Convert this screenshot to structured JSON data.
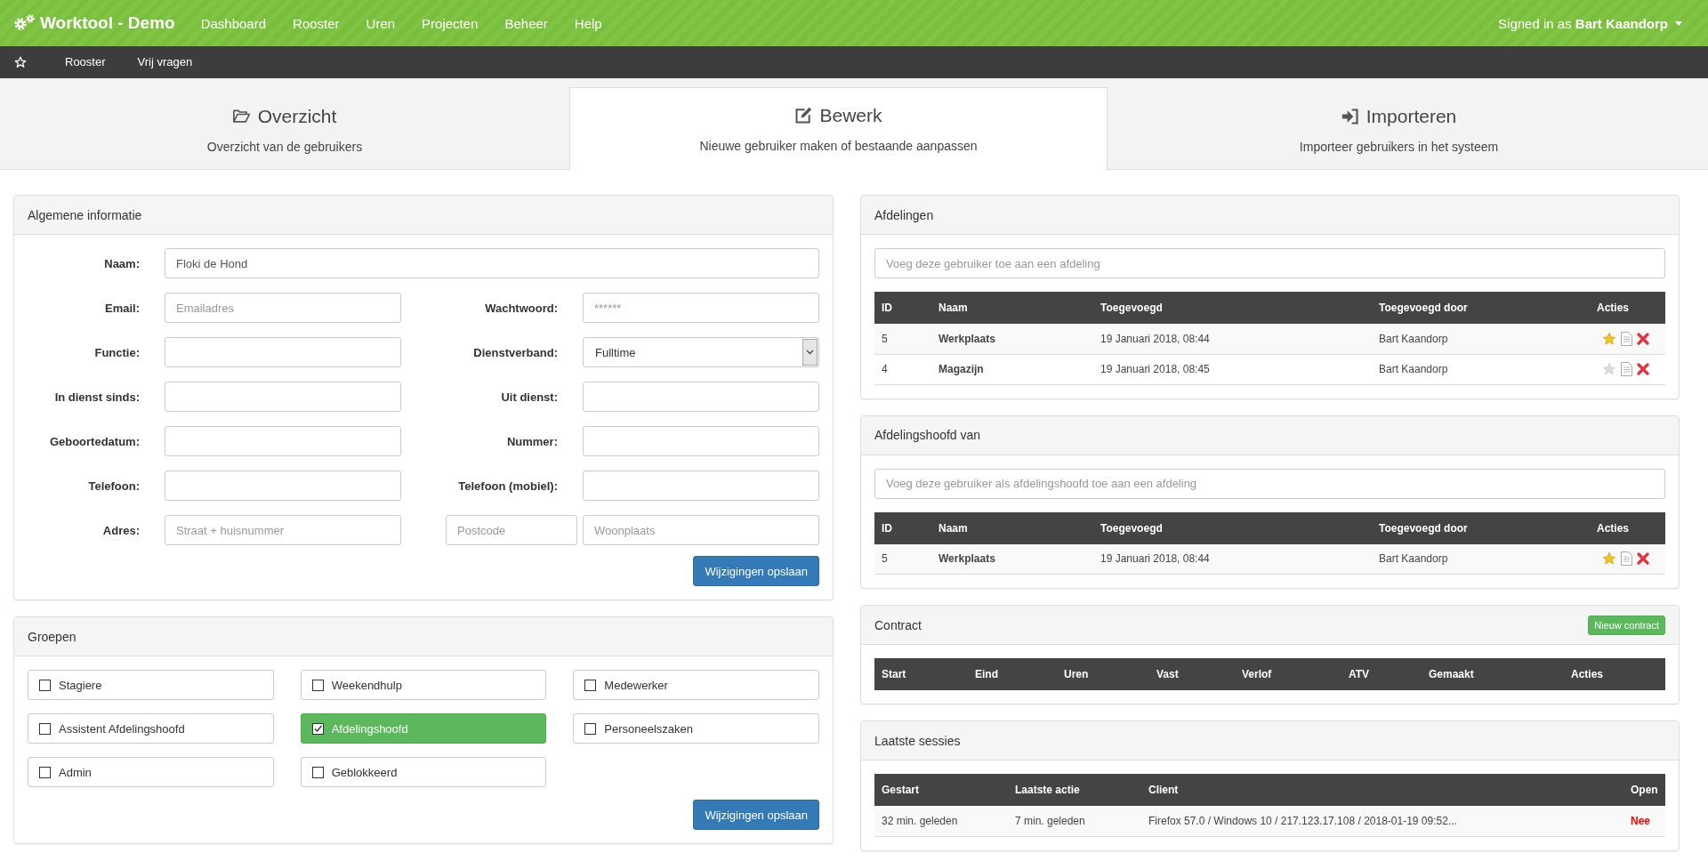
{
  "navbar": {
    "brand": "Worktool - Demo",
    "items": [
      {
        "label": "Dashboard"
      },
      {
        "label": "Rooster"
      },
      {
        "label": "Uren"
      },
      {
        "label": "Projecten"
      },
      {
        "label": "Beheer"
      },
      {
        "label": "Help"
      }
    ],
    "user": "Signed in as **Bart Kaandorp**"
  },
  "subnav": {
    "items": [
      {
        "label": "Rooster"
      },
      {
        "label": "Vrij vragen"
      }
    ]
  },
  "tabs": [
    {
      "title": "Overzicht",
      "subtitle": "Overzicht van de gebruikers",
      "selected": false
    },
    {
      "title": "Bewerk",
      "subtitle": "Nieuwe gebruiker maken of bestaande aanpassen",
      "selected": true
    },
    {
      "title": "Importeren",
      "subtitle": "Importeer gebruikers in het systeem",
      "selected": false
    }
  ],
  "general": {
    "title": "Algemene informatie",
    "rows": [
      [
        {
          "label": "Naam:",
          "kind": "input",
          "value": "Floki de Hond"
        }
      ],
      [
        {
          "label": "Email:",
          "kind": "input",
          "placeholder": "Emailadres"
        },
        {
          "label": "Wachtwoord:",
          "kind": "input",
          "placeholder": "******"
        }
      ],
      [
        {
          "label": "Functie:",
          "kind": "input"
        },
        {
          "label": "Dienstverband:",
          "kind": "select",
          "value": "Fulltime"
        }
      ],
      [
        {
          "label": "In dienst sinds:",
          "kind": "input"
        },
        {
          "label": "Uit dienst:",
          "kind": "input"
        }
      ],
      [
        {
          "label": "Geboortedatum:",
          "kind": "input"
        },
        {
          "label": "Nummer:",
          "kind": "input"
        }
      ],
      [
        {
          "label": "Telefoon:",
          "kind": "input"
        },
        {
          "label": "Telefoon (mobiel):",
          "kind": "input"
        }
      ],
      [
        {
          "label": "Adres:",
          "kind": "address",
          "inputs": [
            {
              "placeholder": "Straat + huisnummer"
            },
            {
              "placeholder": "Postcode"
            },
            {
              "placeholder": "Woonplaats"
            }
          ]
        }
      ]
    ],
    "save_button": "Wijzigingen opslaan"
  },
  "groups": {
    "title": "Groepen",
    "items": [
      {
        "label": "Stagiere",
        "checked": false
      },
      {
        "label": "Weekendhulp",
        "checked": false
      },
      {
        "label": "Medewerker",
        "checked": false
      },
      {
        "label": "Assistent Afdelingshoofd",
        "checked": false
      },
      {
        "label": "Afdelingshoofd",
        "checked": true
      },
      {
        "label": "Personeelszaken",
        "checked": false
      },
      {
        "label": "Admin",
        "checked": false
      },
      {
        "label": "Geblokkeerd",
        "checked": false
      }
    ],
    "save_button": "Wijzigingen opslaan"
  },
  "departments": {
    "title": "Afdelingen",
    "search": {
      "placeholder": "Voeg deze gebruiker toe aan een afdeling"
    },
    "columns": [
      "ID",
      "Naam",
      "Toegevoegd",
      "Toegevoegd door",
      "Acties"
    ],
    "rows": [
      {
        "id": "5",
        "name": "Werkplaats",
        "added": "19 Januari 2018, 08:44",
        "added_by": "Bart Kaandorp",
        "primary": true
      },
      {
        "id": "4",
        "name": "Magazijn",
        "added": "19 Januari 2018, 08:45",
        "added_by": "Bart Kaandorp",
        "primary": false
      }
    ]
  },
  "head_of": {
    "title": "Afdelingshoofd van",
    "search": {
      "placeholder": "Voeg deze gebruiker als afdelingshoofd toe aan een afdeling"
    },
    "columns": [
      "ID",
      "Naam",
      "Toegevoegd",
      "Toegevoegd door",
      "Acties"
    ],
    "rows": [
      {
        "id": "5",
        "name": "Werkplaats",
        "added": "19 Januari 2018, 08:44",
        "added_by": "Bart Kaandorp",
        "primary": true
      }
    ]
  },
  "contract": {
    "title": "Contract",
    "new_button": "Nieuw contract",
    "columns": [
      "Start",
      "Eind",
      "Uren",
      "Vast",
      "Verlof",
      "ATV",
      "Gemaakt",
      "Acties"
    ]
  },
  "sessions": {
    "title": "Laatste sessies",
    "columns": [
      "Gestart",
      "Laatste actie",
      "Client",
      "Open"
    ],
    "rows": [
      {
        "started": "32 min. geleden",
        "last_action": "7 min. geleden",
        "client": "Firefox 57.0 / Windows 10 / 217.123.17.108 / 2018-01-19 09:52...",
        "open": "Nee",
        "is_open": false
      }
    ]
  }
}
